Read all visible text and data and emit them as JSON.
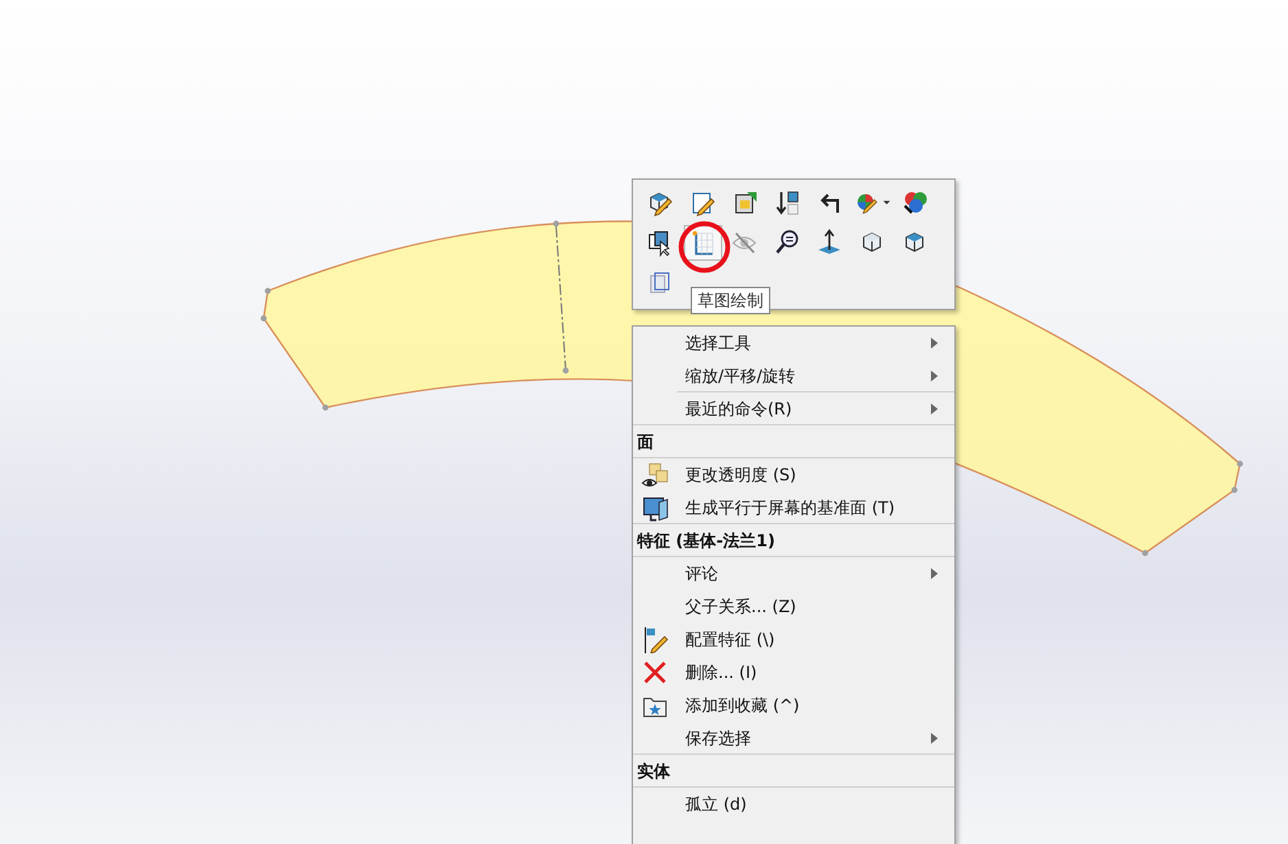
{
  "toolbar": {
    "buttons": [
      {
        "selected": false
      },
      {
        "selected": false
      },
      {
        "selected": false
      },
      {
        "selected": false
      },
      {
        "selected": false
      },
      {
        "selected": false
      },
      {
        "selected": false
      },
      {
        "selected": false
      },
      {
        "selected": true
      },
      {
        "selected": false
      },
      {
        "selected": false
      },
      {
        "selected": false
      },
      {
        "selected": false
      },
      {
        "selected": false
      },
      {
        "selected": false
      }
    ],
    "tooltip": "草图绘制"
  },
  "menu": {
    "items": [
      {
        "kind": "item",
        "label": "选择工具",
        "submenu": true,
        "divider": false
      },
      {
        "kind": "item",
        "label": "缩放/平移/旋转",
        "submenu": true,
        "divider": true
      },
      {
        "kind": "item",
        "label": "最近的命令(R)",
        "submenu": true,
        "divider": true
      },
      {
        "kind": "header",
        "label": "面",
        "divider": true
      },
      {
        "kind": "item",
        "label": "更改透明度 (S)",
        "submenu": false,
        "divider": false
      },
      {
        "kind": "item",
        "label": "生成平行于屏幕的基准面 (T)",
        "submenu": false,
        "divider": true
      },
      {
        "kind": "header",
        "label": "特征 (基体-法兰1)",
        "divider": true
      },
      {
        "kind": "item",
        "label": "评论",
        "submenu": true,
        "divider": false
      },
      {
        "kind": "item",
        "label": "父子关系... (Z)",
        "submenu": false,
        "divider": false
      },
      {
        "kind": "item",
        "label": "配置特征 (\\)",
        "submenu": false,
        "divider": false
      },
      {
        "kind": "item",
        "label": "删除... (I)",
        "submenu": false,
        "divider": false
      },
      {
        "kind": "item",
        "label": "添加到收藏 (^)",
        "submenu": false,
        "divider": false
      },
      {
        "kind": "item",
        "label": "保存选择",
        "submenu": true,
        "divider": true
      },
      {
        "kind": "header",
        "label": "实体",
        "divider": true
      },
      {
        "kind": "item",
        "label": "孤立 (d)",
        "submenu": false,
        "divider": false
      }
    ]
  }
}
